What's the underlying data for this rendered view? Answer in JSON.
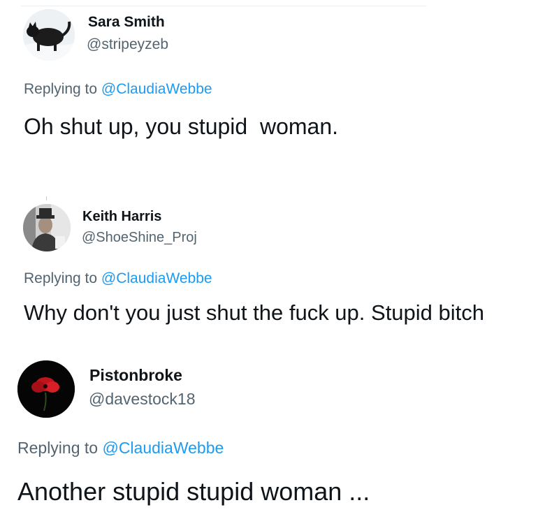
{
  "tweets": [
    {
      "display_name": "Sara Smith",
      "handle": "@stripeyzeb",
      "replying_prefix": "Replying to ",
      "replying_mention": "@ClaudiaWebbe",
      "text": "Oh shut up, you stupid  woman.",
      "avatar_icon": "black-cat-in-snow-avatar"
    },
    {
      "display_name": "Keith Harris",
      "handle": "@ShoeShine_Proj",
      "replying_prefix": "Replying to ",
      "replying_mention": "@ClaudiaWebbe",
      "text": "Why don't you just shut the fuck up. Stupid bitch",
      "avatar_icon": "man-with-hat-photo-avatar"
    },
    {
      "display_name": "Pistonbroke",
      "handle": "@davestock18",
      "replying_prefix": "Replying to ",
      "replying_mention": "@ClaudiaWebbe",
      "text": "Another stupid stupid woman ...",
      "avatar_icon": "red-poppy-avatar"
    }
  ],
  "colors": {
    "name": "#0f1419",
    "secondary": "#536471",
    "mention": "#1d9bf0",
    "background": "#ffffff"
  }
}
